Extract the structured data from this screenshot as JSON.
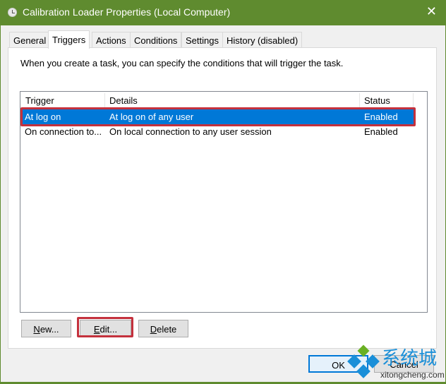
{
  "window": {
    "title": "Calibration Loader Properties (Local Computer)",
    "close": "✕"
  },
  "tabs": [
    {
      "label": "General"
    },
    {
      "label": "Triggers",
      "active": true
    },
    {
      "label": "Actions"
    },
    {
      "label": "Conditions"
    },
    {
      "label": "Settings"
    },
    {
      "label": "History (disabled)"
    }
  ],
  "intro": "When you create a task, you can specify the conditions that will trigger the task.",
  "table": {
    "columns": [
      "Trigger",
      "Details",
      "Status"
    ],
    "rows": [
      {
        "trigger": "At log on",
        "details": "At log on of any user",
        "status": "Enabled",
        "selected": true
      },
      {
        "trigger": "On connection to...",
        "details": "On local connection to any user session",
        "status": "Enabled"
      }
    ]
  },
  "buttons": {
    "new_key": "N",
    "new_rest": "ew...",
    "edit_key": "E",
    "edit_rest": "dit...",
    "delete_key": "D",
    "delete_rest": "elete",
    "ok": "OK",
    "cancel": "Cancel"
  },
  "watermark": {
    "text": "系统城",
    "url_text": "xitongcheng.com"
  },
  "colors": {
    "titlebar": "#5f8b2f",
    "selection": "#0078d7",
    "highlight": "#c4313d"
  }
}
